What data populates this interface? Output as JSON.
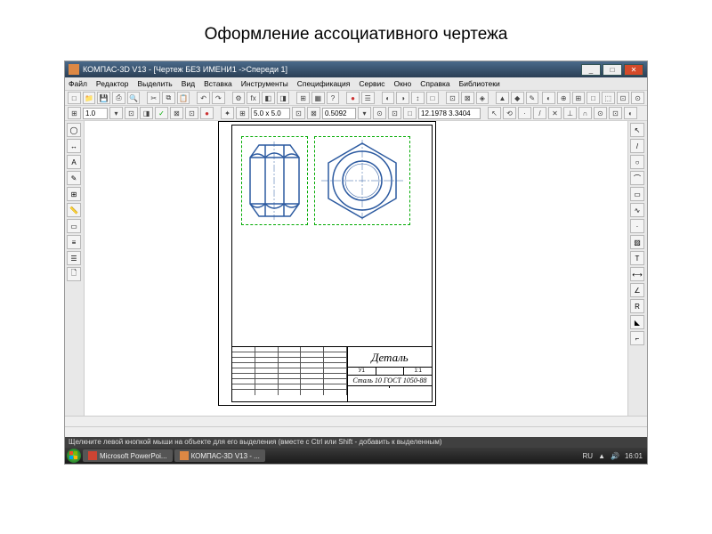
{
  "slide": {
    "title": "Оформление ассоциативного чертежа"
  },
  "titlebar": {
    "app": "КОМПАС-3D V13",
    "doc": "[Чертеж БЕЗ ИМЕНИ1 ->Спереди 1]"
  },
  "menu": [
    "Файл",
    "Редактор",
    "Выделить",
    "Вид",
    "Вставка",
    "Инструменты",
    "Спецификация",
    "Сервис",
    "Окно",
    "Справка",
    "Библиотеки"
  ],
  "toolbar2": {
    "zoom": "1.0",
    "coords": "5.0 x 5.0",
    "scale": "0.5092",
    "xy": "12.1978  3.3404"
  },
  "drawing": {
    "part_name": "Деталь",
    "material": "Сталь 10  ГОСТ 1050-88",
    "lit": "У1",
    "mass": "1:1"
  },
  "hint": "Щелкните левой кнопкой мыши на объекте для его выделения (вместе с Ctrl или Shift - добавить к выделенным)",
  "taskbar": {
    "btn1": "Microsoft PowerPoi...",
    "btn2": "КОМПАС-3D V13 - ...",
    "lang": "RU",
    "time": "16:01"
  }
}
